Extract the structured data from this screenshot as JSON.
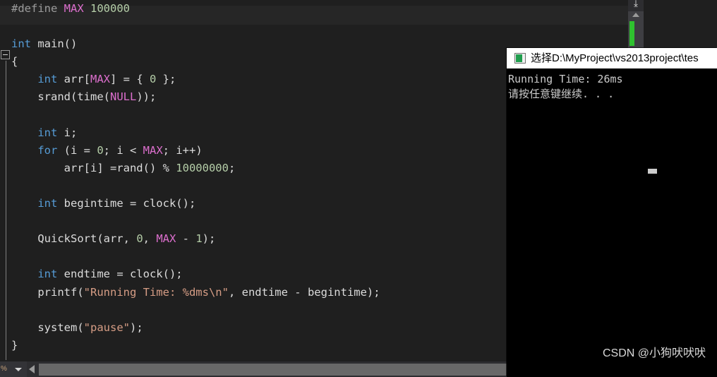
{
  "editor": {
    "background_color": "#1f1f1f",
    "current_line_color": "#262626",
    "fold_icon": "fold-collapse-icon",
    "code_lines": [
      {
        "indent": 0,
        "tokens": [
          {
            "t": "pre",
            "v": "#define "
          },
          {
            "t": "mac",
            "v": "MAX"
          },
          {
            "t": "pln",
            "v": " "
          },
          {
            "t": "num",
            "v": "100000"
          }
        ]
      },
      {
        "indent": 0,
        "tokens": []
      },
      {
        "indent": 0,
        "tokens": [
          {
            "t": "kw",
            "v": "int"
          },
          {
            "t": "pln",
            "v": " main()"
          }
        ]
      },
      {
        "indent": 0,
        "tokens": [
          {
            "t": "pln",
            "v": "{"
          }
        ]
      },
      {
        "indent": 0,
        "tokens": [
          {
            "t": "pln",
            "v": "    "
          },
          {
            "t": "kw",
            "v": "int"
          },
          {
            "t": "pln",
            "v": " arr["
          },
          {
            "t": "mac",
            "v": "MAX"
          },
          {
            "t": "pln",
            "v": "] = { "
          },
          {
            "t": "num",
            "v": "0"
          },
          {
            "t": "pln",
            "v": " };"
          }
        ]
      },
      {
        "indent": 0,
        "tokens": [
          {
            "t": "pln",
            "v": "    srand(time("
          },
          {
            "t": "mac",
            "v": "NULL"
          },
          {
            "t": "pln",
            "v": "));"
          }
        ]
      },
      {
        "indent": 0,
        "tokens": []
      },
      {
        "indent": 0,
        "tokens": [
          {
            "t": "pln",
            "v": "    "
          },
          {
            "t": "kw",
            "v": "int"
          },
          {
            "t": "pln",
            "v": " i;"
          }
        ]
      },
      {
        "indent": 0,
        "tokens": [
          {
            "t": "pln",
            "v": "    "
          },
          {
            "t": "kw",
            "v": "for"
          },
          {
            "t": "pln",
            "v": " (i = "
          },
          {
            "t": "num",
            "v": "0"
          },
          {
            "t": "pln",
            "v": "; i < "
          },
          {
            "t": "mac",
            "v": "MAX"
          },
          {
            "t": "pln",
            "v": "; i++)"
          }
        ]
      },
      {
        "indent": 0,
        "tokens": [
          {
            "t": "pln",
            "v": "        arr[i] =rand() % "
          },
          {
            "t": "num",
            "v": "10000000"
          },
          {
            "t": "pln",
            "v": ";"
          }
        ]
      },
      {
        "indent": 0,
        "tokens": []
      },
      {
        "indent": 0,
        "tokens": [
          {
            "t": "pln",
            "v": "    "
          },
          {
            "t": "kw",
            "v": "int"
          },
          {
            "t": "pln",
            "v": " begintime = clock();"
          }
        ]
      },
      {
        "indent": 0,
        "tokens": []
      },
      {
        "indent": 0,
        "tokens": [
          {
            "t": "pln",
            "v": "    QuickSort(arr, "
          },
          {
            "t": "num",
            "v": "0"
          },
          {
            "t": "pln",
            "v": ", "
          },
          {
            "t": "mac",
            "v": "MAX"
          },
          {
            "t": "pln",
            "v": " - "
          },
          {
            "t": "num",
            "v": "1"
          },
          {
            "t": "pln",
            "v": ");"
          }
        ]
      },
      {
        "indent": 0,
        "tokens": []
      },
      {
        "indent": 0,
        "tokens": [
          {
            "t": "pln",
            "v": "    "
          },
          {
            "t": "kw",
            "v": "int"
          },
          {
            "t": "pln",
            "v": " endtime = clock();"
          }
        ]
      },
      {
        "indent": 0,
        "tokens": [
          {
            "t": "pln",
            "v": "    printf("
          },
          {
            "t": "str",
            "v": "\"Running Time: %dms\\n\""
          },
          {
            "t": "pln",
            "v": ", endtime - begintime);"
          }
        ]
      },
      {
        "indent": 0,
        "tokens": []
      },
      {
        "indent": 0,
        "tokens": [
          {
            "t": "pln",
            "v": "    system("
          },
          {
            "t": "str",
            "v": "\"pause\""
          },
          {
            "t": "pln",
            "v": ");"
          }
        ]
      },
      {
        "indent": 0,
        "tokens": [
          {
            "t": "pln",
            "v": "}"
          }
        ]
      }
    ]
  },
  "scrollbars": {
    "vertical": {
      "top_icon": "scroll-to-top-icon",
      "up_arrow": "chevron-up-icon",
      "health_indicator_color": "#2fc22f"
    },
    "horizontal": {
      "zoom_value": "%",
      "left_arrow": "chevron-left-icon"
    }
  },
  "console": {
    "icon": "console-window-icon",
    "title": "选择D:\\MyProject\\vs2013project\\tes",
    "lines": [
      "Running Time: 26ms",
      "请按任意键继续. . ."
    ]
  },
  "watermark": {
    "text": "CSDN @小狗吠吠吠"
  }
}
